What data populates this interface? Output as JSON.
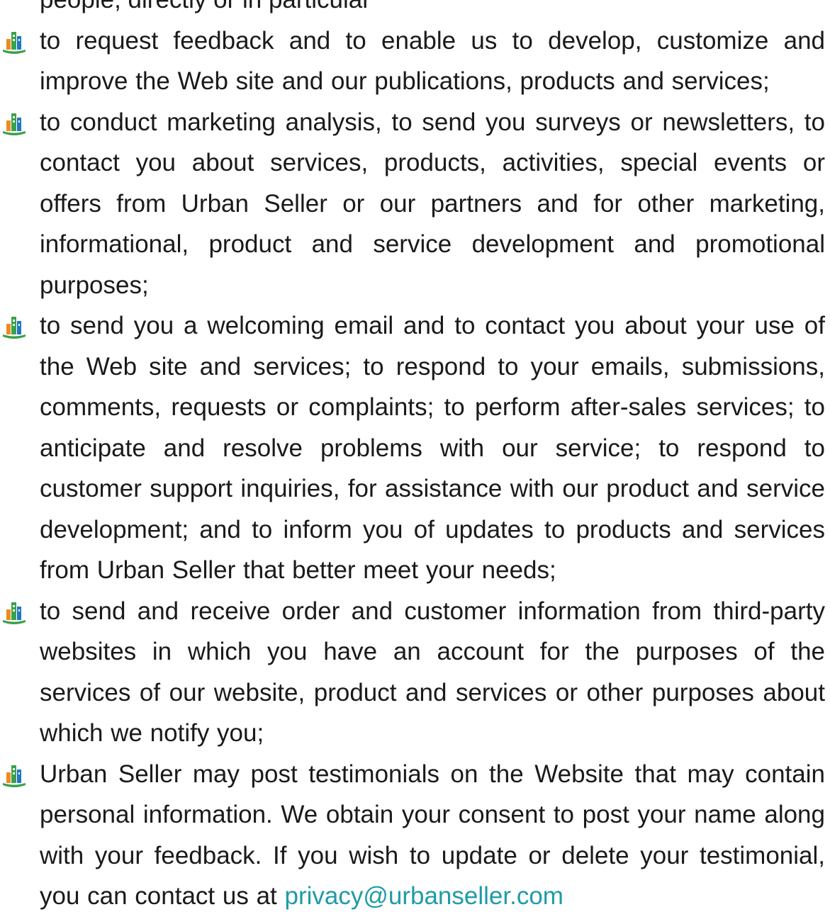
{
  "document": {
    "top_cut_line": "people, directly or in particular",
    "items": [
      {
        "text": "to request feedback and to enable us to develop, customize and improve the Web site and our publications, products and services;"
      },
      {
        "text": "to conduct marketing analysis, to send you surveys or newsletters, to contact you about services, products, activities, special events or offers from Urban Seller or our partners and for other marketing, informational, product and service development and promotional purposes;"
      },
      {
        "text": "to send you a welcoming email and to contact you about your use of the Web site and services; to respond to your emails, submissions, comments, requests or complaints; to perform after-sales services; to anticipate and resolve problems with our service; to respond to customer support inquiries, for assistance with our product and service development; and to inform you of updates to products and services from Urban Seller that better meet your needs;"
      },
      {
        "text": "to send and receive order and customer information from third-party websites in which you have an account for the purposes of the services of our website, product and services or other purposes about which we notify you;"
      },
      {
        "text": "Urban Seller may post testimonials on the Website that may contain personal information. We obtain your consent to post your name along with your feedback. If you wish to update or delete your testimonial, you can contact us at ",
        "link": "privacy@urbanseller.com"
      }
    ]
  },
  "bullet_icon": "city-buildings-icon",
  "colors": {
    "text": "#1a1a1a",
    "link": "#1f9ba7",
    "bullet_green": "#3aa14a",
    "bullet_orange": "#f08a1c",
    "bullet_blue": "#1e78c2"
  }
}
